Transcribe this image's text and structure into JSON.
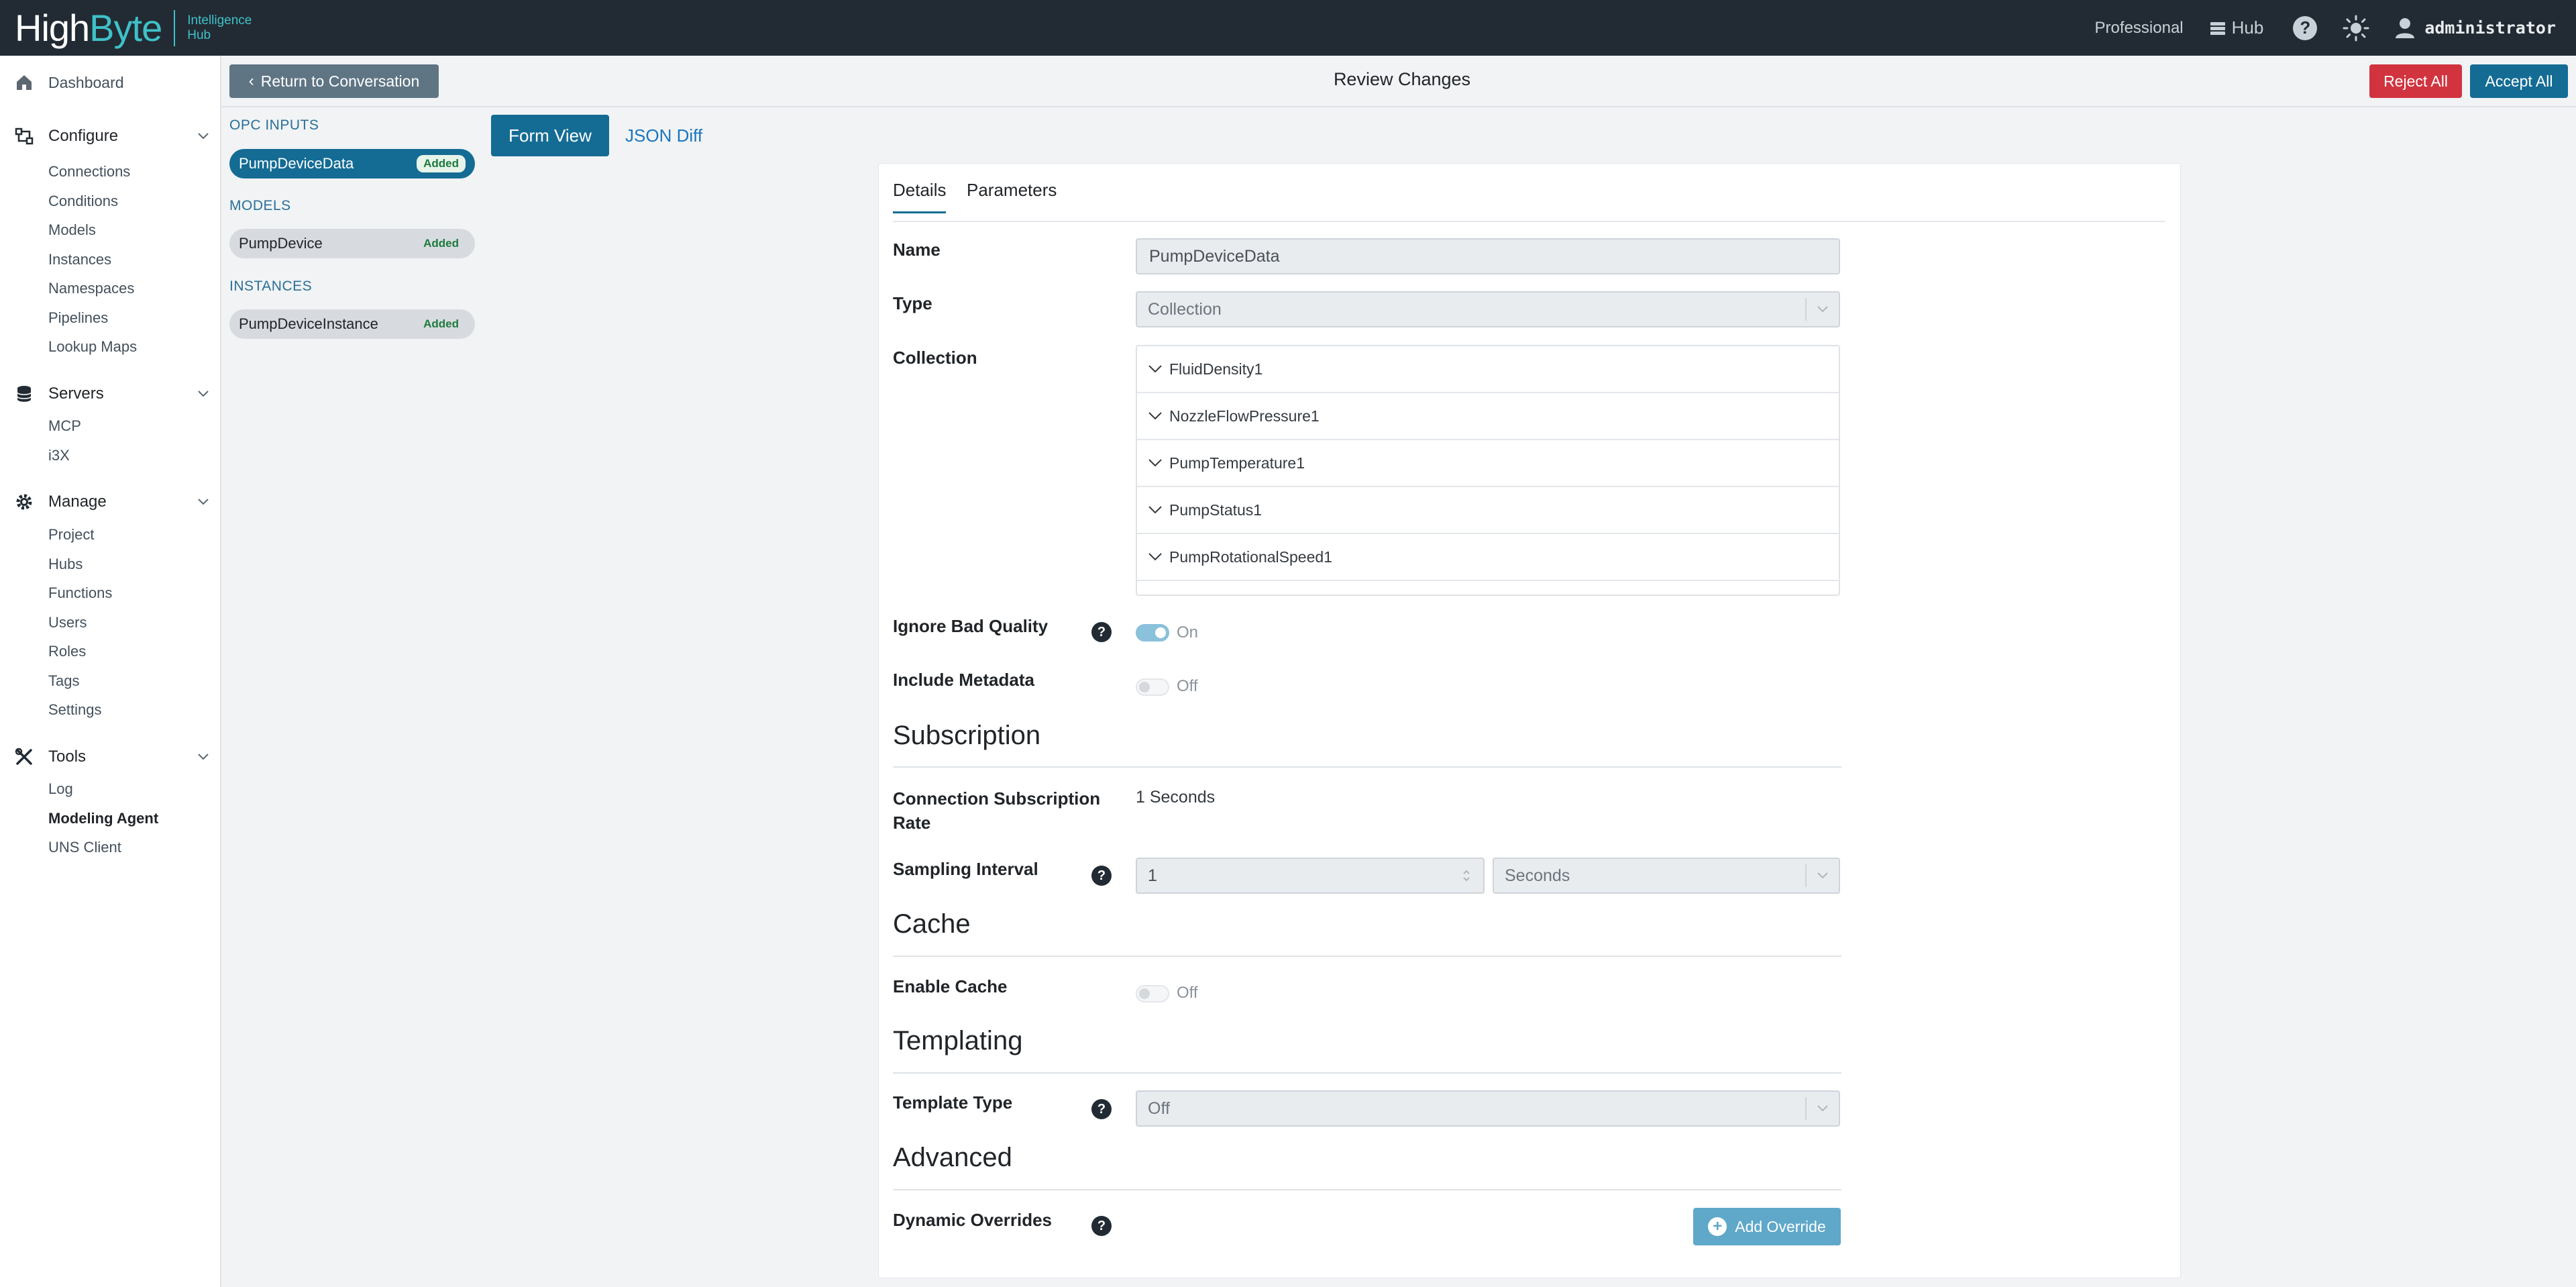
{
  "brand": {
    "name_a": "High",
    "name_b": "Byte",
    "sub1": "Intelligence",
    "sub2": "Hub"
  },
  "topbar": {
    "edition": "Professional",
    "hub_label": "Hub",
    "help": "?",
    "username": "administrator"
  },
  "nav": {
    "dashboard": "Dashboard",
    "configure": {
      "label": "Configure",
      "items": [
        "Connections",
        "Conditions",
        "Models",
        "Instances",
        "Namespaces",
        "Pipelines",
        "Lookup Maps"
      ]
    },
    "servers": {
      "label": "Servers",
      "items": [
        "MCP",
        "i3X"
      ]
    },
    "manage": {
      "label": "Manage",
      "items": [
        "Project",
        "Hubs",
        "Functions",
        "Users",
        "Roles",
        "Tags",
        "Settings"
      ]
    },
    "tools": {
      "label": "Tools",
      "items": [
        "Log",
        "Modeling Agent",
        "UNS Client"
      ]
    }
  },
  "header": {
    "return_label": "Return to Conversation",
    "title": "Review Changes",
    "reject_label": "Reject All",
    "accept_label": "Accept All"
  },
  "changes": {
    "opc_head": "OPC INPUTS",
    "opc_item": {
      "name": "PumpDeviceData",
      "badge": "Added"
    },
    "models_head": "MODELS",
    "models_item": {
      "name": "PumpDevice",
      "badge": "Added"
    },
    "instances_head": "INSTANCES",
    "instances_item": {
      "name": "PumpDeviceInstance",
      "badge": "Added"
    }
  },
  "view": {
    "form": "Form View",
    "json": "JSON Diff"
  },
  "card": {
    "tab_details": "Details",
    "tab_parameters": "Parameters",
    "name_label": "Name",
    "name_value": "PumpDeviceData",
    "type_label": "Type",
    "type_value": "Collection",
    "collection_label": "Collection",
    "collection_items": [
      "FluidDensity1",
      "NozzleFlowPressure1",
      "PumpTemperature1",
      "PumpStatus1",
      "PumpRotationalSpeed1"
    ],
    "ignore_label": "Ignore Bad Quality",
    "ignore_state": "On",
    "metadata_label": "Include Metadata",
    "metadata_state": "Off",
    "subscription_head": "Subscription",
    "conn_rate_label_1": "Connection Subscription",
    "conn_rate_label_2": "Rate",
    "conn_rate_value": "1 Seconds",
    "sampling_label": "Sampling Interval",
    "sampling_value": "1",
    "sampling_unit": "Seconds",
    "cache_head": "Cache",
    "cache_label": "Enable Cache",
    "cache_state": "Off",
    "templating_head": "Templating",
    "template_label": "Template Type",
    "template_value": "Off",
    "advanced_head": "Advanced",
    "overrides_label": "Dynamic Overrides",
    "add_override_label": "Add Override"
  }
}
